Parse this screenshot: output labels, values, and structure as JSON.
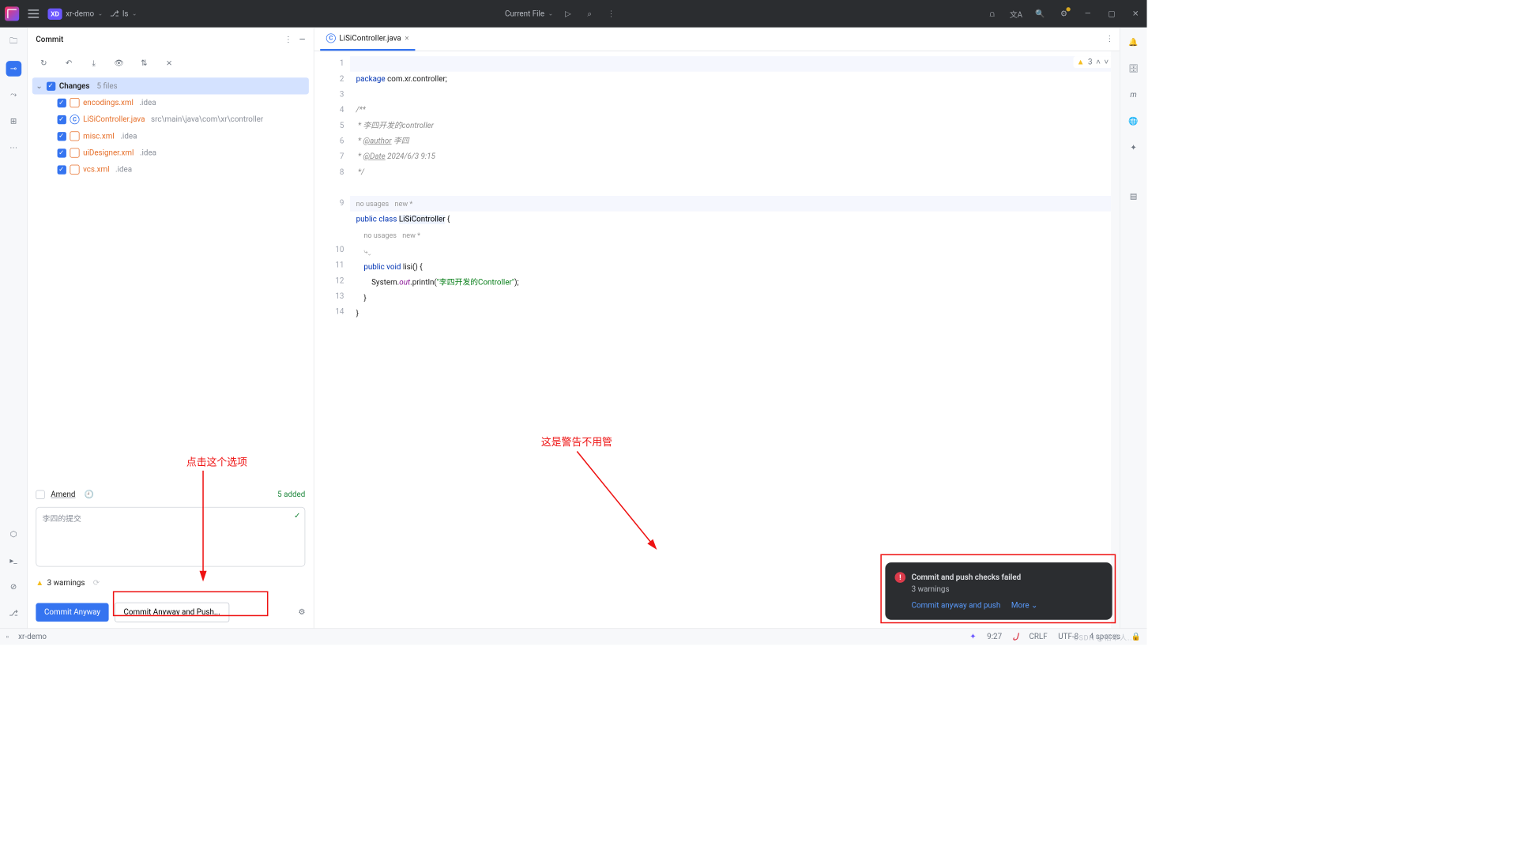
{
  "titlebar": {
    "project_badge": "XD",
    "project": "xr-demo",
    "branch": "ls",
    "run_config": "Current File"
  },
  "lrail": [
    "folder",
    "commit",
    "pull-requests",
    "structure",
    "more"
  ],
  "commit_panel": {
    "title": "Commit",
    "changes_label": "Changes",
    "file_count": "5 files",
    "files": [
      {
        "name": "encodings.xml",
        "path": ".idea",
        "type": "xml"
      },
      {
        "name": "LiSiController.java",
        "path": "src\\main\\java\\com\\xr\\controller",
        "type": "java"
      },
      {
        "name": "misc.xml",
        "path": ".idea",
        "type": "xml"
      },
      {
        "name": "uiDesigner.xml",
        "path": ".idea",
        "type": "xml"
      },
      {
        "name": "vcs.xml",
        "path": ".idea",
        "type": "xml"
      }
    ],
    "amend_label": "Amend",
    "added_label": "5 added",
    "commit_message": "李四的提交",
    "warnings_label": "3 warnings",
    "btn_commit": "Commit Anyway",
    "btn_commit_push": "Commit Anyway and Push..."
  },
  "editor": {
    "tab_name": "LiSiController.java",
    "inspector_count": "3",
    "usages_hint": "no usages",
    "new_hint": "new *",
    "lines": {
      "pkg": "package com.xr.controller;",
      "c1": "/**",
      "c2": " * 李四开发的controller",
      "c3": " * @author 李四",
      "c4": " * @Date 2024/6/3 9:15",
      "c5": " */",
      "cls_decl_a": "public class ",
      "cls_name": "LiSiController",
      "cls_decl_b": " {",
      "m_decl": "    public void lisi() {",
      "m_body_a": "        System.",
      "m_body_out": "out",
      "m_body_b": ".println(",
      "m_body_str": "\"李四开发的Controller\"",
      "m_body_c": ");",
      "m_close": "    }",
      "cls_close": "}"
    }
  },
  "toast": {
    "title": "Commit and push checks failed",
    "sub": "3 warnings",
    "link1": "Commit anyway and push",
    "link2": "More"
  },
  "annotations": {
    "text1": "点击这个选项",
    "text2": "这是警告不用管"
  },
  "statusbar": {
    "project": "xr-demo",
    "time": "9:27",
    "lineending": "CRLF",
    "encoding": "UTF-8",
    "indent": "4 spaces"
  }
}
